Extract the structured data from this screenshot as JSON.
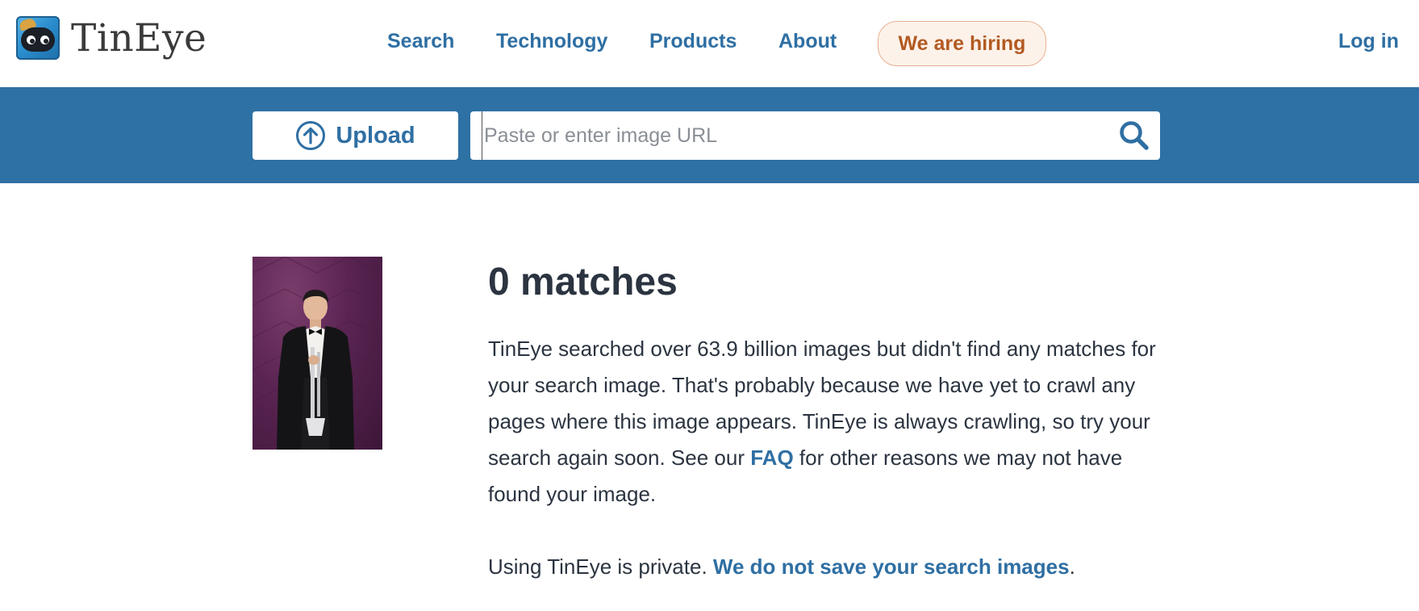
{
  "header": {
    "brand": "TinEye",
    "nav": [
      {
        "label": "Search"
      },
      {
        "label": "Technology"
      },
      {
        "label": "Products"
      },
      {
        "label": "About"
      }
    ],
    "hiring_label": "We are hiring",
    "login_label": "Log in"
  },
  "search": {
    "upload_label": "Upload",
    "url_placeholder": "Paste or enter image URL",
    "url_value": ""
  },
  "result": {
    "title": "0 matches",
    "body_part1": "TinEye searched over 63.9 billion images but didn't find any matches for your search image. That's probably because we have yet to crawl any pages where this image appears. TinEye is always crawling, so try your search again soon. See our ",
    "faq_link": "FAQ",
    "body_part2": " for other reasons we may not have found your image.",
    "privacy_text": "Using TinEye is private. ",
    "privacy_link": "We do not save your search images",
    "privacy_end": "."
  },
  "colors": {
    "accent": "#2f6fa3",
    "band": "#2e71a4",
    "hiring_text": "#b35a22",
    "hiring_bg": "#fdf2ea"
  },
  "icons": {
    "upload": "upload-arrow-circle-icon",
    "search": "magnifier-icon",
    "logo": "tineye-robot-logo-icon"
  }
}
